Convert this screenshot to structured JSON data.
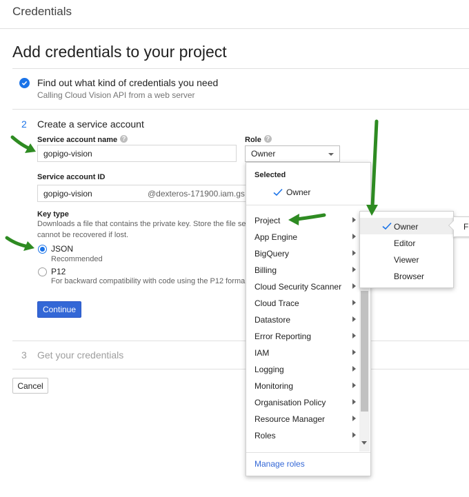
{
  "header": {
    "title": "Credentials"
  },
  "page": {
    "title": "Add credentials to your project"
  },
  "step1": {
    "title": "Find out what kind of credentials you need",
    "subtitle": "Calling Cloud Vision API from a web server"
  },
  "step2": {
    "number": "2",
    "title": "Create a service account",
    "service_account_name_label": "Service account name",
    "service_account_name_value": "gopigo-vision",
    "role_label": "Role",
    "role_value": "Owner",
    "service_account_id_label": "Service account ID",
    "service_account_id_value": "gopigo-vision",
    "service_account_id_suffix": "@dexteros-171900.iam.gs",
    "key_type_label": "Key type",
    "key_type_desc_line1": "Downloads a file that contains the private key. Store the file se",
    "key_type_desc_line2": "cannot be recovered if lost.",
    "json_label": "JSON",
    "json_sub": "Recommended",
    "p12_label": "P12",
    "p12_sub": "For backward compatibility with code using the P12 forma",
    "continue_label": "Continue"
  },
  "step3": {
    "number": "3",
    "title": "Get your credentials"
  },
  "cancel_label": "Cancel",
  "role_menu": {
    "selected_header": "Selected",
    "selected_item": "Owner",
    "categories": [
      "Project",
      "App Engine",
      "BigQuery",
      "Billing",
      "Cloud Security Scanner",
      "Cloud Trace",
      "Datastore",
      "Error Reporting",
      "IAM",
      "Logging",
      "Monitoring",
      "Organisation Policy",
      "Resource Manager",
      "Roles"
    ],
    "manage_roles": "Manage roles"
  },
  "project_submenu": {
    "items": [
      "Owner",
      "Editor",
      "Viewer",
      "Browser"
    ],
    "checked": "Owner"
  },
  "tooltip_fragment": "Fu",
  "colors": {
    "accent": "#1a73e8",
    "button": "#3367d6",
    "arrow": "#2e8b22"
  }
}
